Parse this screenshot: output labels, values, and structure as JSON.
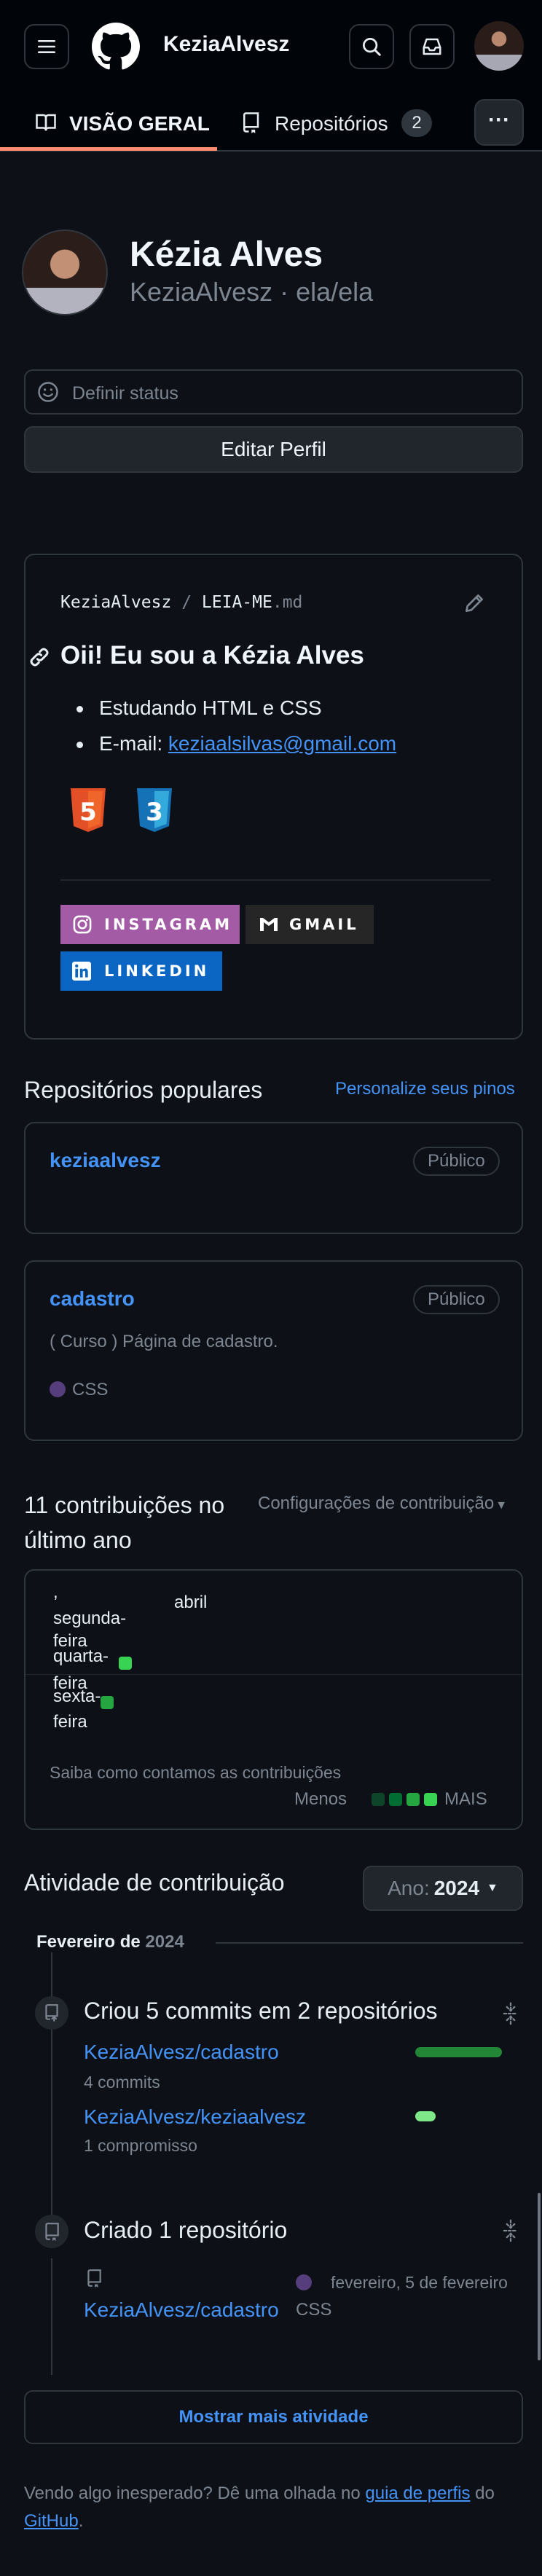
{
  "header": {
    "username": "KeziaAlvesz",
    "menu_icon": "hamburger-menu-icon",
    "logo_icon": "github-logo-icon",
    "search_icon": "search-icon",
    "inbox_icon": "inbox-icon"
  },
  "tabs": {
    "overview": "VISÃO GERAL",
    "repositories": "Repositórios",
    "repositories_count": "2",
    "more": "···"
  },
  "profile": {
    "name": "Kézia Alves",
    "handle_line": "KeziaAlvesz · ela/ela",
    "status_placeholder": "Definir status",
    "edit_label": "Editar Perfil"
  },
  "readme": {
    "breadcrumb_user": "KeziaAlvesz",
    "breadcrumb_sep": "/",
    "breadcrumb_file": "LEIA-ME",
    "breadcrumb_ext": ".md",
    "heading": "Oii! Eu sou a Kézia Alves",
    "bullet1": "Estudando HTML e CSS",
    "bullet2_prefix": "E-mail: ",
    "email": "keziaalsilvas@gmail.com",
    "html5_label": "5",
    "css3_label": "3",
    "badges": {
      "instagram": "INSTAGRAM",
      "gmail": "GMAIL",
      "linkedin": "LINKEDIN"
    }
  },
  "popular": {
    "title": "Repositórios populares",
    "customize": "Personalize seus pinos",
    "repos": [
      {
        "name": "keziaalvesz",
        "visibility": "Público",
        "description": "",
        "language": ""
      },
      {
        "name": "cadastro",
        "visibility": "Público",
        "description": "( Curso ) Página de cadastro.",
        "language": "CSS"
      }
    ],
    "css_color": "#563d7c"
  },
  "contributions": {
    "title_line1": "11 contribuições no",
    "title_line2": "último ano",
    "settings": "Configurações de contribuição",
    "month": "abril",
    "comma": ",",
    "day_monday": "segunda-",
    "day_feira1": "feira",
    "day_wednesday": "quarta-",
    "day_feira2": "feira",
    "day_friday": "sexta-",
    "day_feira3": "feira",
    "learn": "Saiba como contamos as contribuições",
    "less": "Menos",
    "more": "MAIS",
    "level_colors": [
      "#0e4429",
      "#006d32",
      "#26a641",
      "#39d353"
    ]
  },
  "activity": {
    "title": "Atividade de contribuição",
    "year_label": "Ano: ",
    "year_value": "2024",
    "month_label": "Fevereiro de",
    "month_year": "2024",
    "commits_title": "Criou 5 commits em 2 repositórios",
    "commit_items": [
      {
        "repo": "KeziaAlvesz/cadastro",
        "count": "4 commits",
        "share": 0.8
      },
      {
        "repo": "KeziaAlvesz/keziaalvesz",
        "count": "1 compromisso",
        "share": 0.2
      }
    ],
    "created_title": "Criado 1 repositório",
    "created_repo": "KeziaAlvesz/cadastro",
    "created_lang": "CSS",
    "created_date": "fevereiro, 5 de fevereiro",
    "show_more": "Mostrar mais atividade"
  },
  "footer": {
    "text1": "Vendo algo inesperado? Dê uma olhada no ",
    "guide_link": "guia de perfis",
    "text2": " do",
    "github_link": "GitHub",
    "period": "."
  }
}
